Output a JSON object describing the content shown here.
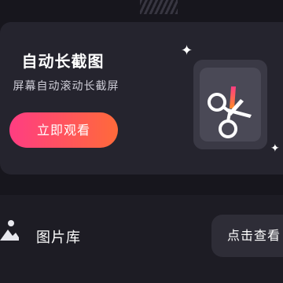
{
  "feature": {
    "title": "自动长截图",
    "subtitle": "屏幕自动滚动长截屏",
    "cta_label": "立即观看",
    "accent_gradient": [
      "#ff3d82",
      "#ff6a3a"
    ]
  },
  "gallery": {
    "label": "图片库",
    "view_button_label": "点击查看"
  },
  "icons": {
    "feature_icon": "scissors-icon",
    "gallery_icon": "image-icon",
    "decoration": "sparkle-icon"
  }
}
